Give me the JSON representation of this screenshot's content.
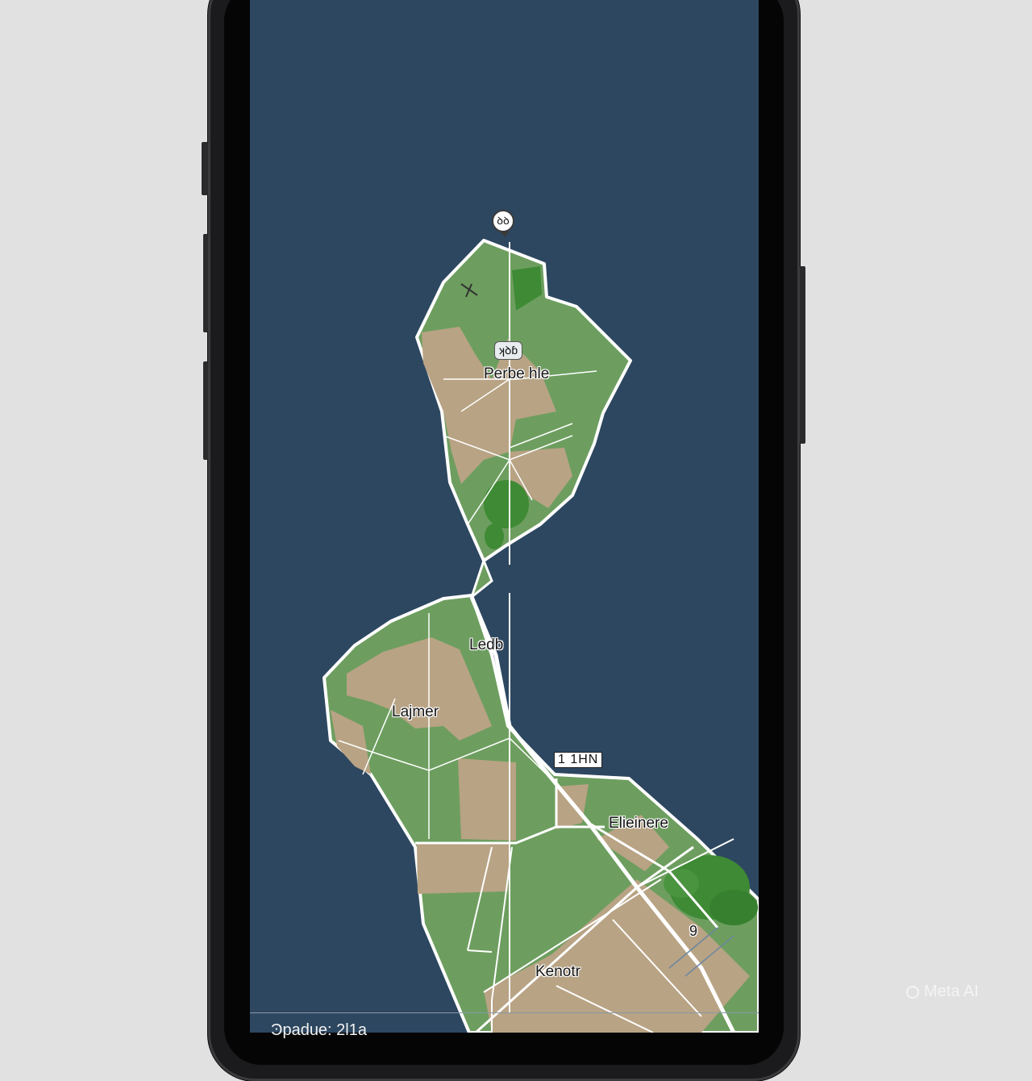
{
  "map": {
    "place_labels": [
      "Perbe hle",
      "Ledb",
      "Lajmer",
      "Elieinere",
      "Kenotr"
    ],
    "pin_top": "ꝺꝺ",
    "marker_center": "ʞꝺɓ",
    "box_marker": "1 1HN",
    "small_marker": "9"
  },
  "status_bar": {
    "text": "Ͽpadue: 2l1a"
  },
  "watermark": {
    "text": "Meta AI",
    "icon": "meta-ai-ring-icon"
  },
  "colors": {
    "water": "#2d4760",
    "land_green": "#6d9e5f",
    "land_tan": "#b8a384",
    "forest": "#3f8a35",
    "roads": "#ffffff"
  }
}
